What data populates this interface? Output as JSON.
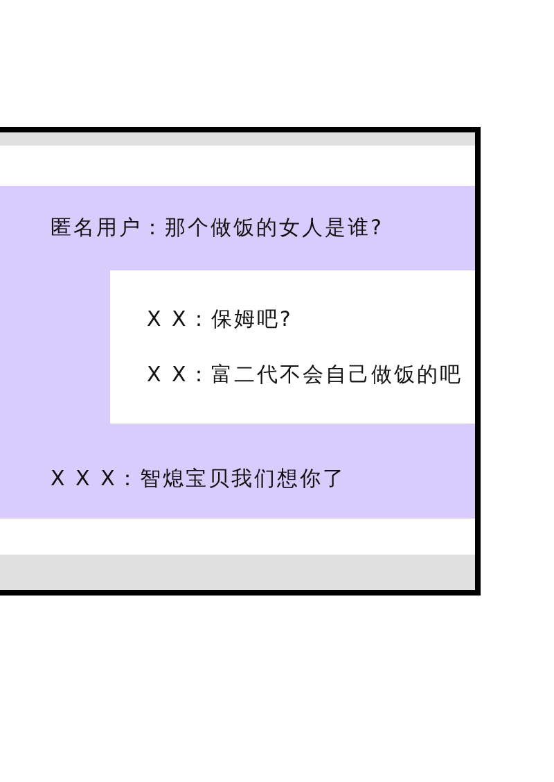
{
  "comments": [
    {
      "text": "匿名用户：那个做饭的女人是谁?",
      "replies": [
        {
          "text": "X X：保姆吧?"
        },
        {
          "text": "X X：富二代不会自己做饭的吧"
        }
      ]
    },
    {
      "text": "X X X：智熄宝贝我们想你了"
    }
  ]
}
